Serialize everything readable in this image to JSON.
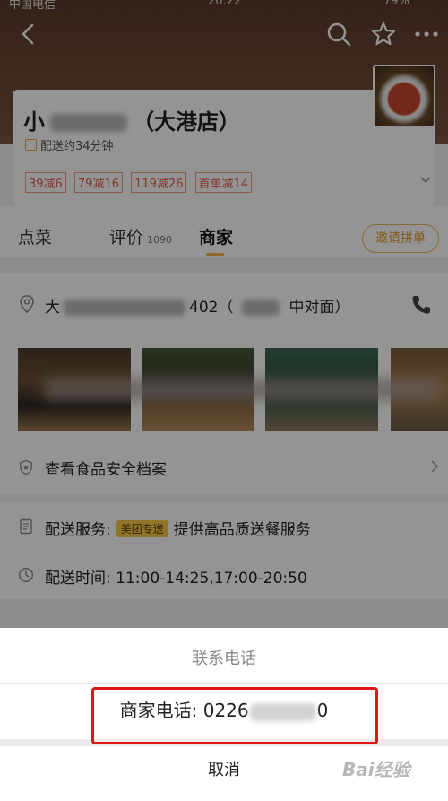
{
  "status": {
    "carrier": "中国电信",
    "time": "20:22",
    "battery": "79%"
  },
  "header": {
    "back_icon": "chevron-left-icon",
    "search_icon": "search-icon",
    "star_icon": "star-icon",
    "more_icon": "more-icon"
  },
  "store": {
    "name_prefix": "小",
    "name_suffix": "（大港店）",
    "delivery_time": "配送约34分钟",
    "promos": [
      "39减6",
      "79减16",
      "119减26",
      "首单减14"
    ]
  },
  "tabs": [
    {
      "label": "点菜"
    },
    {
      "label": "评价",
      "count": "1090"
    },
    {
      "label": "商家"
    }
  ],
  "invite_button": "邀请拼单",
  "address": {
    "start": "大",
    "mid": "402（",
    "end": "中对面）"
  },
  "safety_label": "查看食品安全档案",
  "service": {
    "label": "配送服务:",
    "tag": "美团专送",
    "text": "提供高品质送餐服务"
  },
  "delivery_hours": {
    "label": "配送时间:",
    "value": "11:00-14:25,17:00-20:50"
  },
  "sheet": {
    "title": "联系电话",
    "phone_prefix": "商家电话: 0226",
    "phone_suffix": "0",
    "cancel": "取消"
  },
  "watermark": "Bai经验"
}
